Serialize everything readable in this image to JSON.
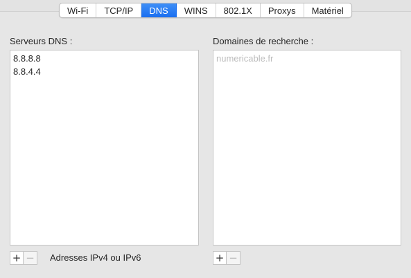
{
  "tabs": [
    {
      "label": "Wi-Fi",
      "active": false
    },
    {
      "label": "TCP/IP",
      "active": false
    },
    {
      "label": "DNS",
      "active": true
    },
    {
      "label": "WINS",
      "active": false
    },
    {
      "label": "802.1X",
      "active": false
    },
    {
      "label": "Proxys",
      "active": false
    },
    {
      "label": "Matériel",
      "active": false
    }
  ],
  "dns_servers": {
    "label": "Serveurs DNS :",
    "items": [
      "8.8.8.8",
      "8.8.4.4"
    ],
    "hint": "Adresses IPv4 ou IPv6",
    "add_icon": "plus-icon",
    "remove_icon": "minus-icon"
  },
  "search_domains": {
    "label": "Domaines de recherche :",
    "placeholder": "numericable.fr",
    "add_icon": "plus-icon",
    "remove_icon": "minus-icon"
  },
  "colors": {
    "accent": "#1a6ff0",
    "background": "#e6e6e6"
  }
}
